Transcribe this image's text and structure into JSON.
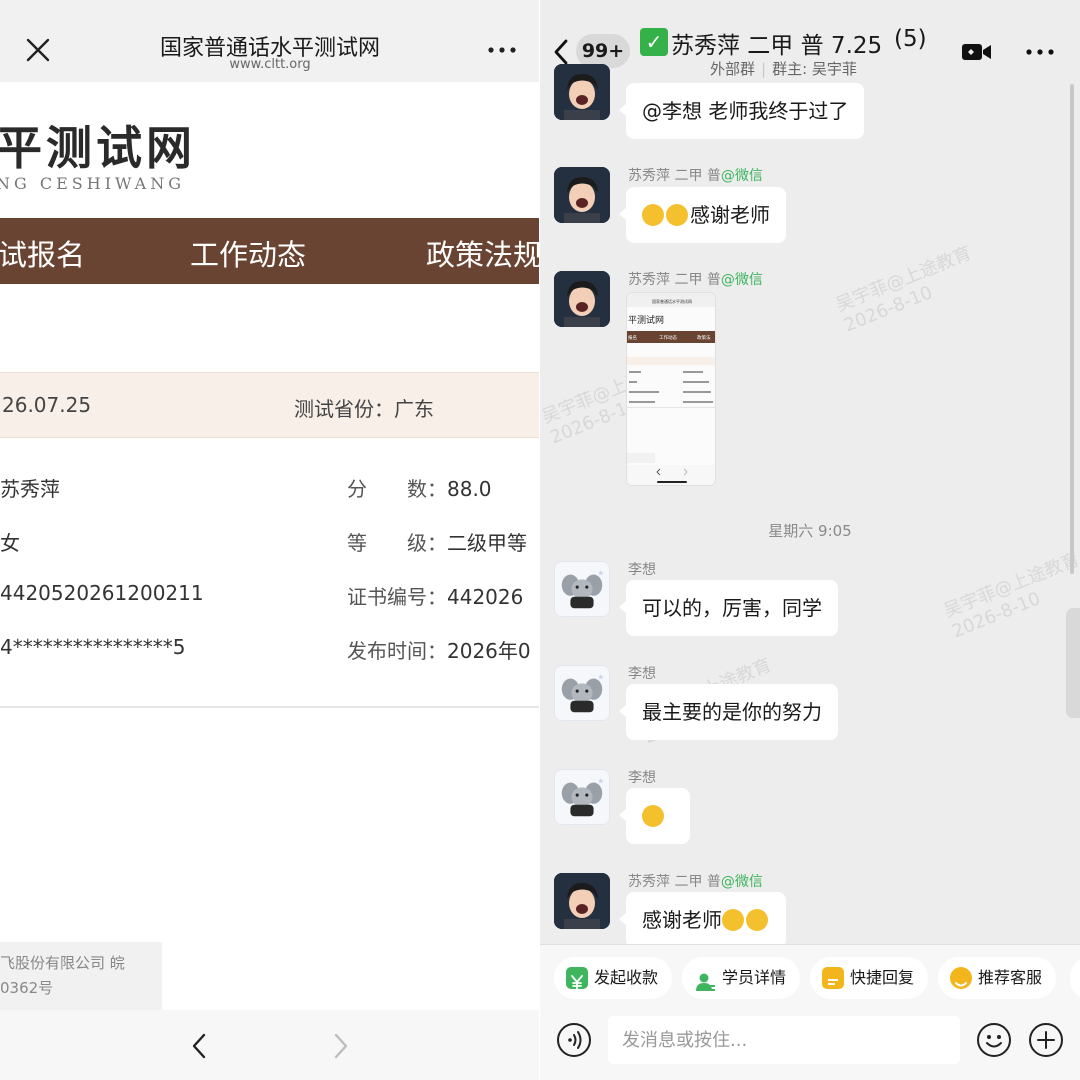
{
  "left_page": {
    "title": "国家普通话水平测试网",
    "url": "www.cltt.org",
    "site_name": "平测试网",
    "site_pinyin": "NG CESHIWANG",
    "nav": [
      "试报名",
      "工作动态",
      "政策法规"
    ],
    "test_date": "26.07.25",
    "province_label": "测试省份：",
    "province_value": "广东",
    "record": {
      "name": "苏秀萍",
      "gender": "女",
      "ticket_no": "4420520261200211",
      "id_no": "4****************5",
      "score_label": "分　　数：",
      "score": "88.0",
      "grade_label": "等　　级：",
      "grade": "二级甲等",
      "cert_label": "证书编号：",
      "cert_no": "442026",
      "publish_label": "发布时间：",
      "publish_time": "2026年0"
    },
    "footer": [
      "飞股份有限公司 皖",
      "0362号"
    ]
  },
  "chat": {
    "unread": "99+",
    "title": "苏秀萍 二甲 普 7.25",
    "count": "(5)",
    "group_type": "外部群",
    "owner": "群主: 吴宇菲",
    "messages": [
      {
        "sender": "",
        "text": "@李想 老师我终于过了"
      },
      {
        "sender": "苏秀萍 二甲 普",
        "tag": "@微信",
        "text": "感谢老师"
      },
      {
        "sender": "苏秀萍 二甲 普",
        "tag": "@微信",
        "text": ""
      },
      {
        "sender": "李想",
        "text": "可以的，厉害，同学"
      },
      {
        "sender": "李想",
        "text": "最主要的是你的努力"
      },
      {
        "sender": "李想",
        "text": ""
      },
      {
        "sender": "苏秀萍 二甲 普",
        "tag": "@微信",
        "text": "感谢老师"
      }
    ],
    "time_separator": "星期六 9:05",
    "watermarks": [
      {
        "name": "吴宇菲@上途教育",
        "date": "2026-8-10"
      },
      {
        "name": "吴宇菲@上途教育",
        "date": "2026-8-10"
      },
      {
        "name": "吴宇菲@上途教育",
        "date": "2026-8-10"
      },
      {
        "name": "吴宇菲@上途教育",
        "date": "2026-8-10"
      }
    ],
    "quick_actions": [
      "发起收款",
      "学员详情",
      "快捷回复",
      "推荐客服"
    ],
    "input_placeholder": "发消息或按住..."
  },
  "thumbnail": {
    "title": "国家普通话水平测试网",
    "site": "平测试网",
    "nav": [
      "报名",
      "工作动态",
      "政策法"
    ]
  },
  "colors": {
    "nav_brown": "#6a4432",
    "info_beige": "#f8efe8",
    "wechat_green": "#3eb55e",
    "check_green": "#34b249"
  }
}
